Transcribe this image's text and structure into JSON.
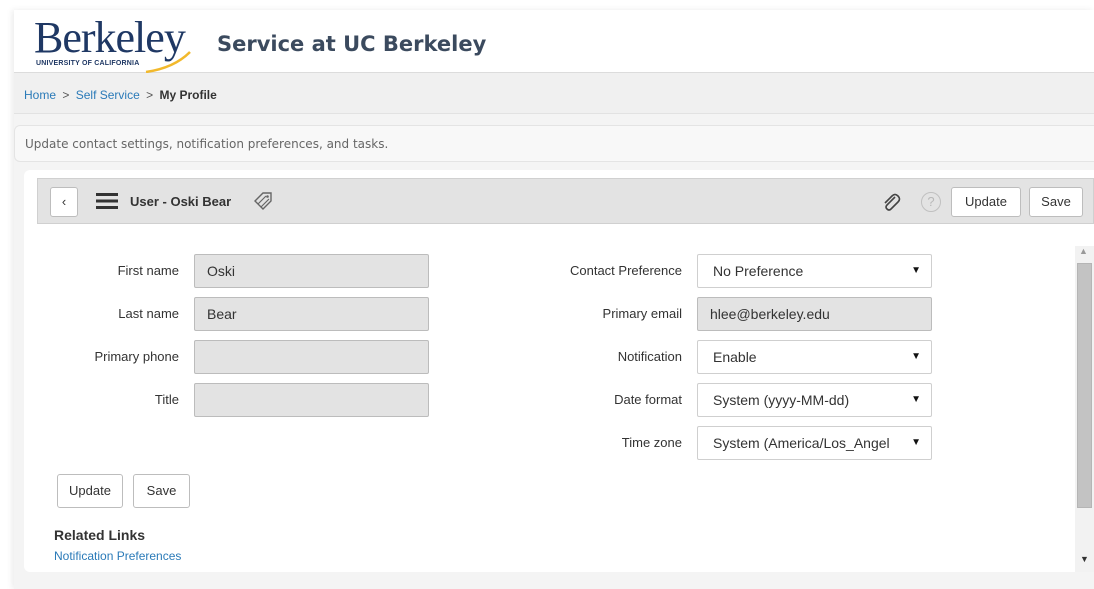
{
  "header": {
    "logo_word": "Berkeley",
    "logo_sub": "UNIVERSITY OF CALIFORNIA",
    "site_title": "Service at UC Berkeley"
  },
  "breadcrumb": {
    "items": [
      "Home",
      "Self Service"
    ],
    "separator": ">",
    "current": "My Profile"
  },
  "description": "Update contact settings, notification preferences, and tasks.",
  "toolbar": {
    "back_glyph": "‹",
    "title": "User - Oski Bear",
    "help_glyph": "?",
    "update_label": "Update",
    "save_label": "Save",
    "icons": [
      "menu-icon",
      "tag-icon",
      "paperclip-icon",
      "help-icon"
    ]
  },
  "form": {
    "first_name": {
      "label": "First name",
      "value": "Oski"
    },
    "last_name": {
      "label": "Last name",
      "value": "Bear"
    },
    "primary_phone": {
      "label": "Primary phone",
      "value": ""
    },
    "title": {
      "label": "Title",
      "value": ""
    },
    "contact_preference": {
      "label": "Contact Preference",
      "value": "No Preference"
    },
    "primary_email": {
      "label": "Primary email",
      "value": "hlee@berkeley.edu"
    },
    "notification": {
      "label": "Notification",
      "value": "Enable"
    },
    "date_format": {
      "label": "Date format",
      "value": "System (yyyy-MM-dd)"
    },
    "time_zone": {
      "label": "Time zone",
      "value": "System (America/Los_Angel"
    }
  },
  "actions": {
    "update_label": "Update",
    "save_label": "Save"
  },
  "related": {
    "heading": "Related Links",
    "links": [
      "Notification Preferences"
    ]
  },
  "colors": {
    "brand_navy": "#1f3864",
    "link_blue": "#2a7ab8",
    "readonly_field": "#e3e3e3",
    "toolbar_bg": "#e3e3e3"
  }
}
